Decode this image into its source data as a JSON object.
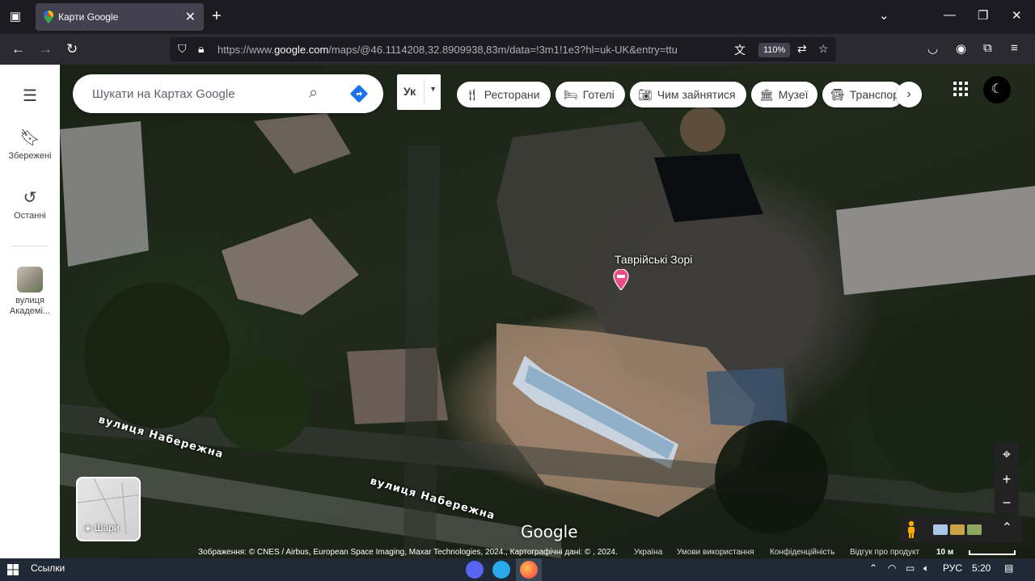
{
  "browser": {
    "tab": {
      "title": "Карти Google"
    },
    "address": {
      "url_prefix": "https://www.",
      "url_domain": "google.com",
      "url_rest": "/maps/@46.1114208,32.8909938,83m/data=!3m1!1e3?hl=uk-UK&entry=ttu"
    },
    "zoom": "110%"
  },
  "sidebar": {
    "menu_icon": "menu-icon",
    "items": [
      {
        "label": "Збережені",
        "icon": "bookmark-icon"
      },
      {
        "label": "Останні",
        "icon": "history-icon"
      },
      {
        "label": "вулиця Академі...",
        "label_line1": "вулиця",
        "label_line2": "Академі...",
        "icon": "place-thumbnail"
      }
    ]
  },
  "search": {
    "placeholder": "Шукати на Картах Google"
  },
  "language_button": {
    "label": "Ук"
  },
  "chips": [
    {
      "label": "Ресторани",
      "icon": "restaurant-icon"
    },
    {
      "label": "Готелі",
      "icon": "hotel-icon"
    },
    {
      "label": "Чим зайнятися",
      "icon": "camera-icon"
    },
    {
      "label": "Музеї",
      "icon": "museum-icon"
    },
    {
      "label": "Транспорт",
      "icon": "transit-icon"
    }
  ],
  "map": {
    "place_label": "Таврійські Зорі",
    "street_label_1": "вулиця Набережна",
    "street_label_2": "вулиця Набережна",
    "layers_label": "Шари",
    "logo": "Google",
    "zoom_in": "+",
    "zoom_out": "−"
  },
  "attribution": {
    "imagery": "Зображення: © CNES / Airbus, European Space Imaging, Maxar Technologies, 2024., Картографічні дані: © , 2024.",
    "country": "Україна",
    "terms": "Умови використання",
    "privacy": "Конфіденційність",
    "feedback": "Відгук про продукт",
    "scale": "10 м"
  },
  "taskbar": {
    "links_label": "Ссылки",
    "lang": "РУС",
    "time": "5:20"
  },
  "colors": {
    "pin": "#ea4c89",
    "directions": "#1a73e8"
  }
}
